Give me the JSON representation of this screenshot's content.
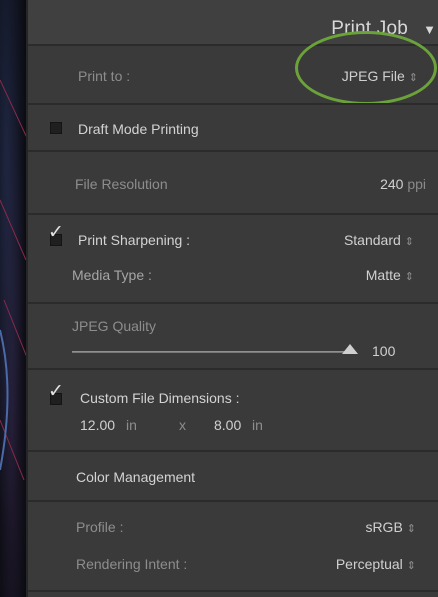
{
  "header": {
    "title": "Print Job",
    "collapse_icon": "triangle-down-icon"
  },
  "print_to": {
    "label": "Print to :",
    "value": "JPEG File"
  },
  "draft_mode": {
    "label": "Draft Mode Printing",
    "checked": false
  },
  "file_resolution": {
    "label": "File Resolution",
    "value": "240",
    "unit": "ppi"
  },
  "print_sharpening": {
    "label": "Print Sharpening :",
    "checked": true,
    "value": "Standard"
  },
  "media_type": {
    "label": "Media Type :",
    "value": "Matte"
  },
  "jpeg_quality": {
    "label": "JPEG Quality",
    "value": "100",
    "slider_fraction": 1.0
  },
  "custom_dimensions": {
    "label": "Custom File Dimensions :",
    "checked": true,
    "width": "12.00",
    "height": "8.00",
    "unit": "in",
    "separator": "x"
  },
  "color_management": {
    "title": "Color Management",
    "profile_label": "Profile :",
    "profile_value": "sRGB",
    "intent_label": "Rendering Intent :",
    "intent_value": "Perceptual"
  },
  "colors": {
    "highlight_ring": "#6ba33a",
    "panel": "#3a3a3a"
  }
}
